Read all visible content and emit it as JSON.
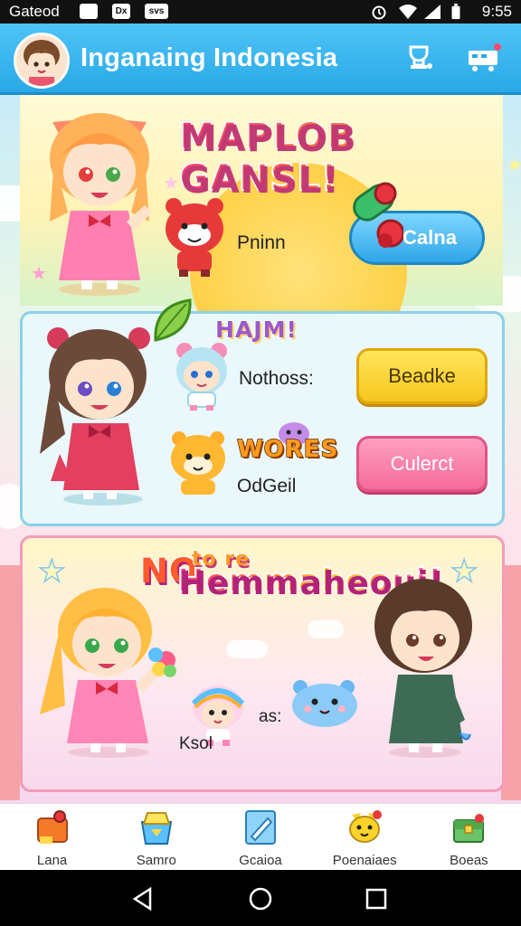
{
  "status_bar": {
    "carrier": "Gateod",
    "icons": [
      "app-icon-1",
      "app-icon-2",
      "app-icon-3"
    ],
    "icon_labels": [
      "",
      "Dx",
      "svs"
    ],
    "time": "9:55"
  },
  "header": {
    "title": "Inganaing Indonesia",
    "avatar_icon": "chibi-avatar",
    "action_icons": [
      "trophy-icon",
      "shop-cart-icon"
    ]
  },
  "panel1": {
    "title": "MAPLOB GANSL!",
    "creature_label": "Pninn",
    "button_label": "Calna"
  },
  "panel2": {
    "title": "HAJM!",
    "row1_label": "Nothoss:",
    "title2": "WORES",
    "row2_label": "OdGeil",
    "button1_label": "Beadke",
    "button2_label": "Culerct"
  },
  "panel3": {
    "title_line1": "NO",
    "title_small": "to re",
    "title_line2": "Hemmaheoui!",
    "creature_label": "Ksol",
    "vs_label": "as:"
  },
  "bottom_nav": {
    "items": [
      {
        "label": "Lana",
        "icon": "puzzle-icon"
      },
      {
        "label": "Samro",
        "icon": "gift-box-icon"
      },
      {
        "label": "Gcaioa",
        "icon": "pencil-card-icon"
      },
      {
        "label": "Poenaiaes",
        "icon": "character-icon"
      },
      {
        "label": "Boeas",
        "icon": "treasure-chest-icon"
      }
    ]
  },
  "colors": {
    "header": "#29a9e6",
    "accent_pink": "#f56b98",
    "accent_yellow": "#f5c61c",
    "accent_blue": "#2fa6e8"
  }
}
